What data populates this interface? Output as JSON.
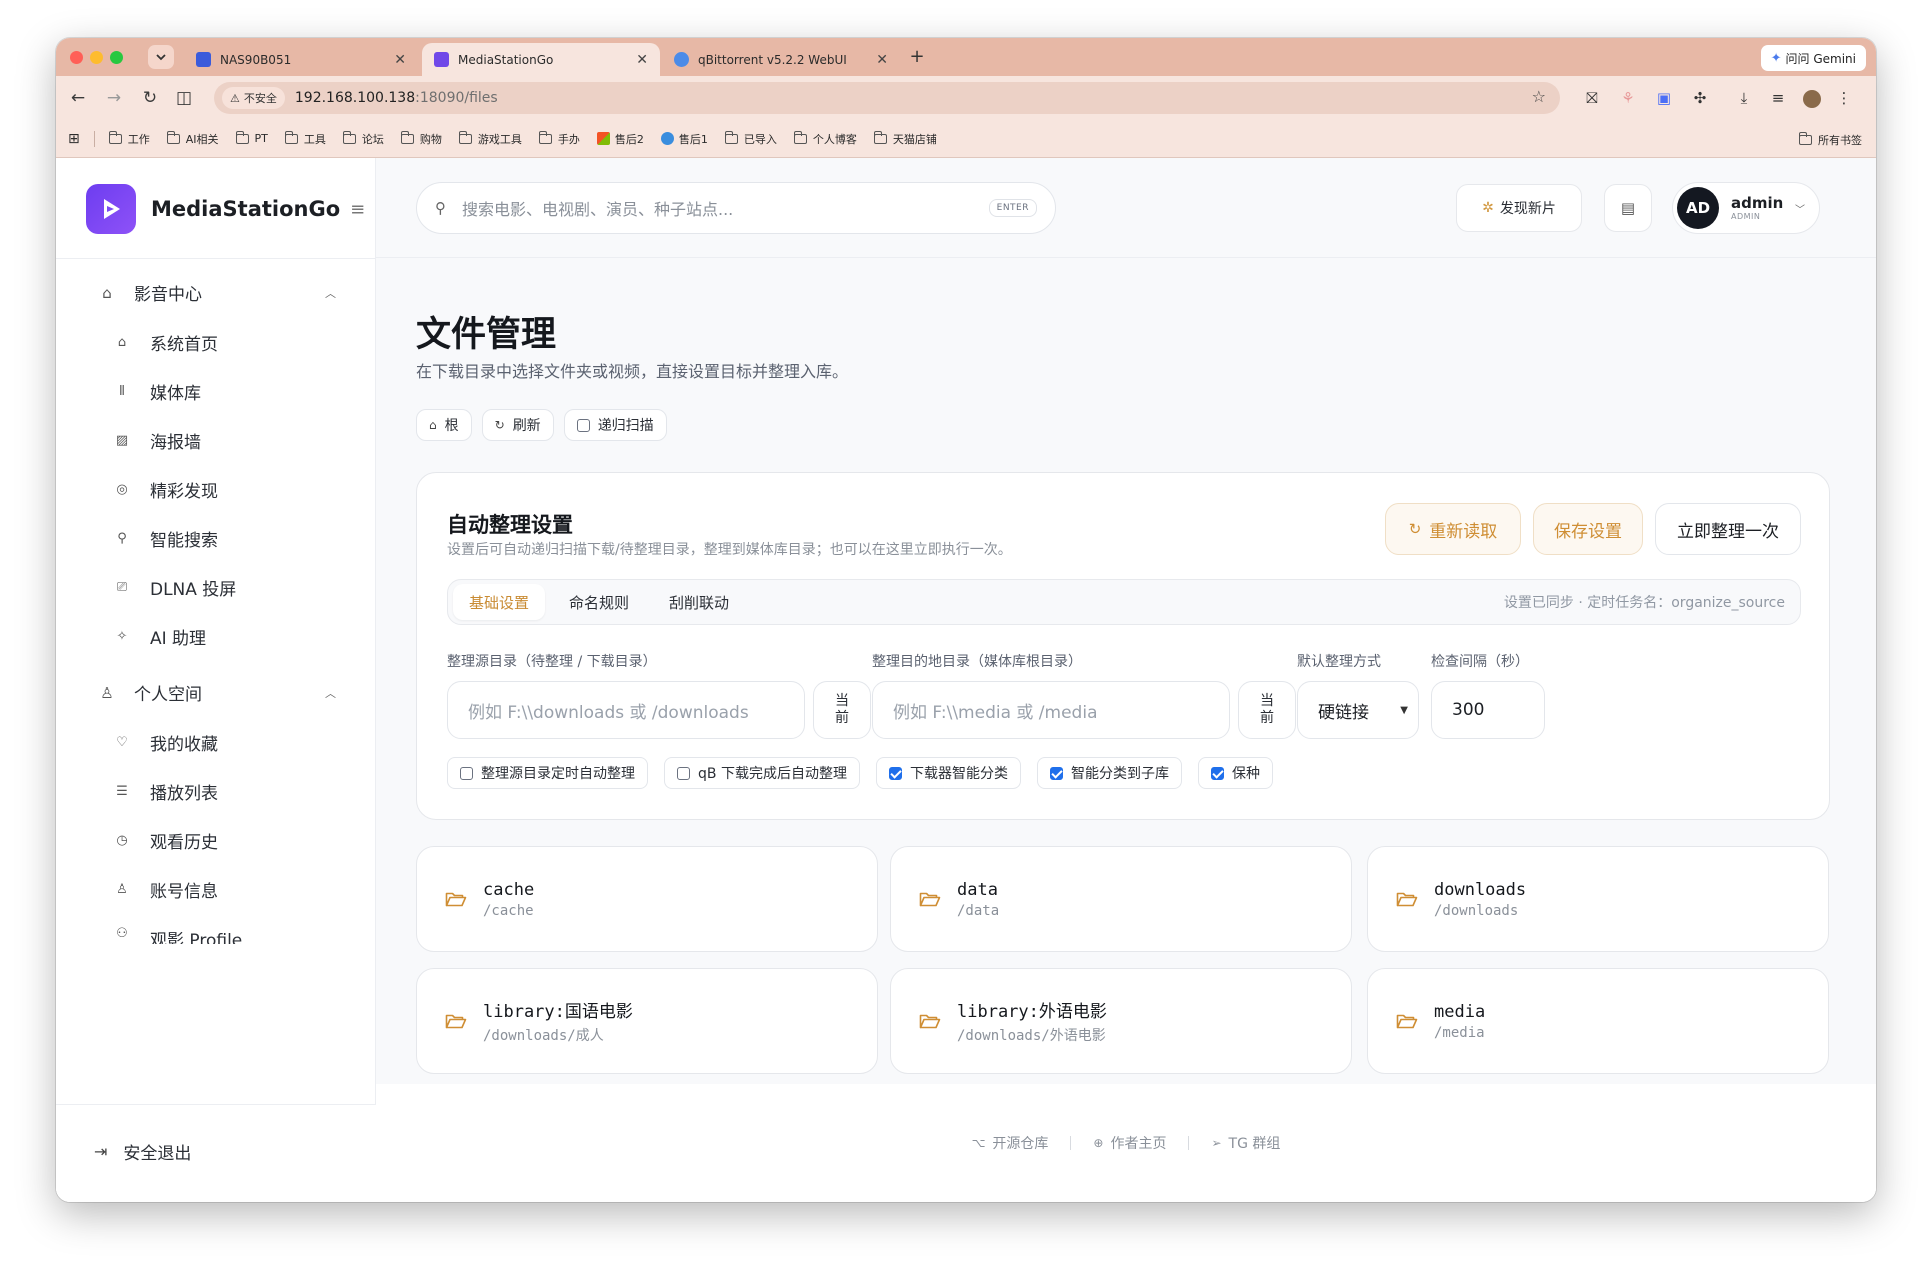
{
  "browser": {
    "tabs": [
      {
        "title": "NAS90B051",
        "favicon_color": "#3b5bdb"
      },
      {
        "title": "MediaStationGo",
        "favicon_color": "#7048e8"
      },
      {
        "title": "qBittorrent v5.2.2 WebUI",
        "favicon_color": "#4c8be8"
      }
    ],
    "new_tab": "+",
    "gemini": "问问 Gemini",
    "security_chip": "不安全",
    "url_host": "192.168.100.138",
    "url_path": ":18090/files",
    "bookmarks": [
      {
        "label": "工作",
        "icon": "folder-icon"
      },
      {
        "label": "AI相关",
        "icon": "folder-icon"
      },
      {
        "label": "PT",
        "icon": "folder-icon"
      },
      {
        "label": "工具",
        "icon": "folder-icon"
      },
      {
        "label": "论坛",
        "icon": "folder-icon"
      },
      {
        "label": "购物",
        "icon": "folder-icon"
      },
      {
        "label": "游戏工具",
        "icon": "folder-icon"
      },
      {
        "label": "手办",
        "icon": "folder-icon"
      },
      {
        "label": "售后2",
        "icon": "windows-icon"
      },
      {
        "label": "售后1",
        "icon": "globe-icon"
      },
      {
        "label": "已导入",
        "icon": "folder-icon"
      },
      {
        "label": "个人博客",
        "icon": "folder-icon"
      },
      {
        "label": "天猫店铺",
        "icon": "folder-icon"
      }
    ],
    "all_bookmarks": "所有书签"
  },
  "sidebar": {
    "brand": "MediaStationGo",
    "groups": [
      {
        "label": "影音中心",
        "icon": "home-icon",
        "items": [
          {
            "label": "系统首页",
            "icon": "home-icon"
          },
          {
            "label": "媒体库",
            "icon": "library-icon"
          },
          {
            "label": "海报墙",
            "icon": "image-icon"
          },
          {
            "label": "精彩发现",
            "icon": "compass-icon"
          },
          {
            "label": "智能搜索",
            "icon": "search-icon"
          },
          {
            "label": "DLNA 投屏",
            "icon": "cast-icon"
          },
          {
            "label": "AI 助理",
            "icon": "sparkle-icon"
          }
        ]
      },
      {
        "label": "个人空间",
        "icon": "user-icon",
        "items": [
          {
            "label": "我的收藏",
            "icon": "heart-icon"
          },
          {
            "label": "播放列表",
            "icon": "playlist-icon"
          },
          {
            "label": "观看历史",
            "icon": "clock-icon"
          },
          {
            "label": "账号信息",
            "icon": "user-icon"
          },
          {
            "label": "观影 Profile",
            "icon": "users-icon"
          }
        ]
      }
    ],
    "logout": "安全退出"
  },
  "topbar": {
    "search_placeholder": "搜索电影、电视剧、演员、种子站点...",
    "enter_hint": "ENTER",
    "discover": "发现新片",
    "user_initials": "AD",
    "user_name": "admin",
    "user_role": "ADMIN"
  },
  "page": {
    "title": "文件管理",
    "subtitle": "在下载目录中选择文件夹或视频，直接设置目标并整理入库。",
    "chips": {
      "root": "根",
      "refresh": "刷新",
      "recursive": "递归扫描"
    }
  },
  "organize": {
    "title": "自动整理设置",
    "subtitle": "设置后可自动递归扫描下载/待整理目录，整理到媒体库目录；也可以在这里立即执行一次。",
    "buttons": {
      "reload": "重新读取",
      "save": "保存设置",
      "run_now": "立即整理一次"
    },
    "tabs": [
      "基础设置",
      "命名规则",
      "刮削联动"
    ],
    "active_tab": "基础设置",
    "sync_note": "设置已同步 · 定时任务名：organize_source",
    "source_label": "整理源目录（待整理 / 下载目录）",
    "source_placeholder": "例如 F:\\\\downloads 或 /downloads",
    "dest_label": "整理目的地目录（媒体库根目录）",
    "dest_placeholder": "例如 F:\\\\media 或 /media",
    "current_btn_top": "当",
    "current_btn_bottom": "前",
    "mode_label": "默认整理方式",
    "mode_value": "硬链接",
    "interval_label": "检查间隔（秒）",
    "interval_value": "300",
    "options": [
      {
        "label": "整理源目录定时自动整理",
        "checked": false
      },
      {
        "label": "qB 下载完成后自动整理",
        "checked": false
      },
      {
        "label": "下载器智能分类",
        "checked": true
      },
      {
        "label": "智能分类到子库",
        "checked": true
      },
      {
        "label": "保种",
        "checked": true
      }
    ]
  },
  "folders": [
    {
      "name": "cache",
      "path": "/cache"
    },
    {
      "name": "data",
      "path": "/data"
    },
    {
      "name": "downloads",
      "path": "/downloads"
    },
    {
      "name": "library:国语电影",
      "path": "/downloads/成人"
    },
    {
      "name": "library:外语电影",
      "path": "/downloads/外语电影"
    },
    {
      "name": "media",
      "path": "/media"
    }
  ],
  "footer": {
    "links": [
      {
        "label": "开源仓库",
        "icon": "github-icon"
      },
      {
        "label": "作者主页",
        "icon": "globe-icon"
      },
      {
        "label": "TG 群组",
        "icon": "send-icon"
      }
    ]
  },
  "colors": {
    "accent": "#c98b33",
    "brand": "#7048e8",
    "check": "#1f6feb"
  }
}
